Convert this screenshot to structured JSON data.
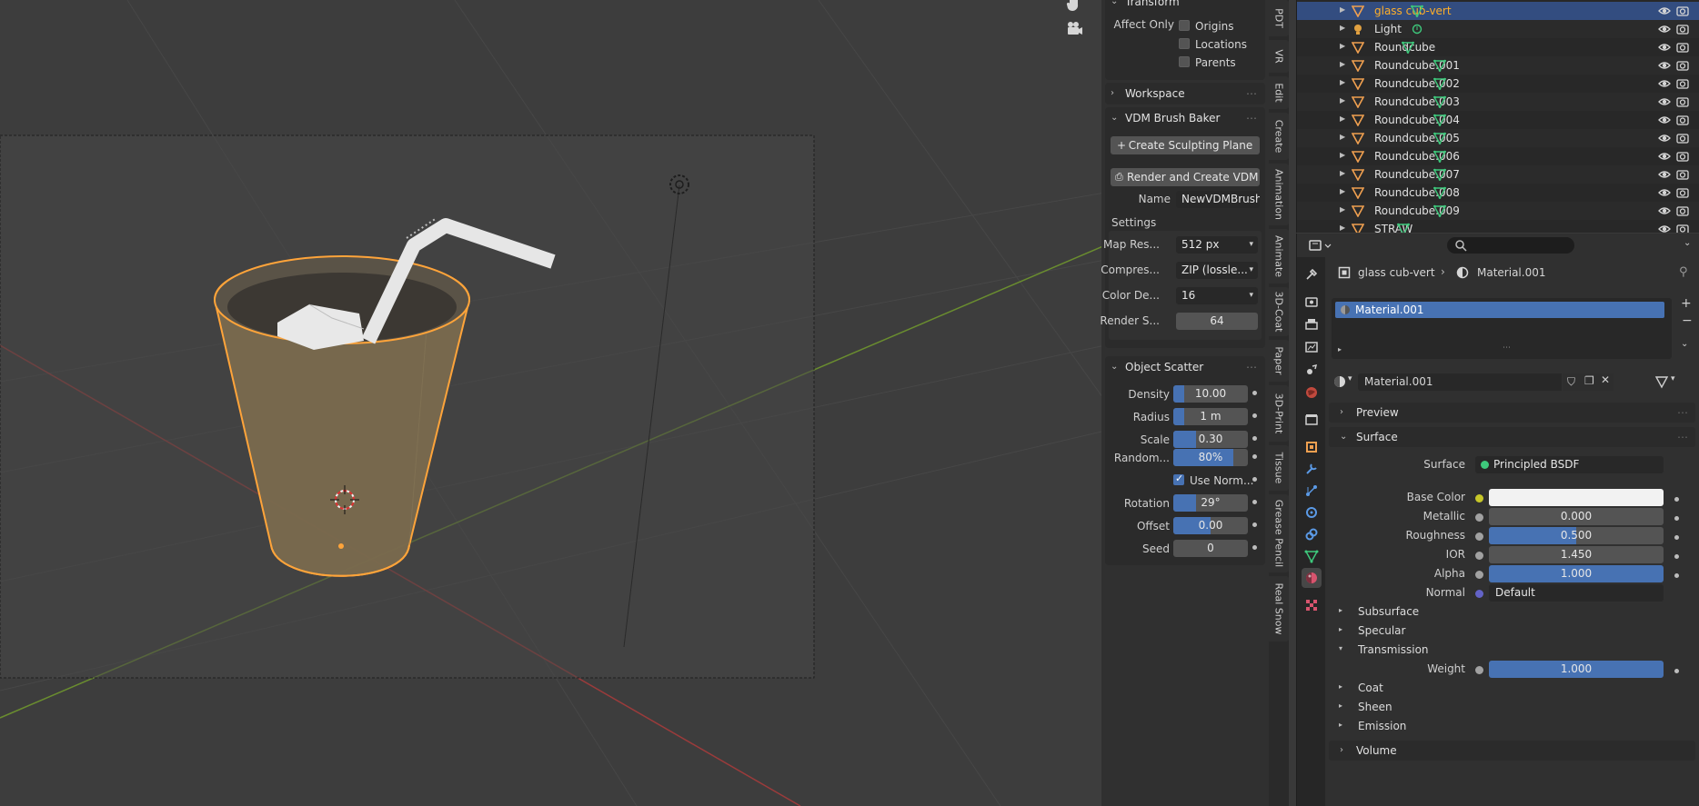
{
  "viewport": {
    "icons": [
      "hand-icon",
      "camera-icon"
    ]
  },
  "npanel": {
    "transform": {
      "title": "Transform",
      "affect_only_label": "Affect Only",
      "options": [
        {
          "label": "Origins",
          "checked": false
        },
        {
          "label": "Locations",
          "checked": false
        },
        {
          "label": "Parents",
          "checked": false
        }
      ]
    },
    "workspace": {
      "title": "Workspace"
    },
    "vdm": {
      "title": "VDM Brush Baker",
      "create_plane": "Create Sculpting Plane",
      "render_create": "Render and Create VDM B...",
      "name_label": "Name",
      "name_value": "NewVDMBrush",
      "settings_label": "Settings",
      "map_res_label": "Map Res...",
      "map_res_value": "512 px",
      "compress_label": "Compres...",
      "compress_value": "ZIP (lossle...",
      "color_depth_label": "Color De...",
      "color_depth_value": "16",
      "render_samples_label": "Render S...",
      "render_samples_value": "64"
    },
    "scatter": {
      "title": "Object Scatter",
      "density_label": "Density",
      "density_value": "10.00",
      "density_fill": 0.15,
      "radius_label": "Radius",
      "radius_value": "1 m",
      "radius_fill": 0.15,
      "scale_label": "Scale",
      "scale_value": "0.30",
      "scale_fill": 0.3,
      "random_label": "Random...",
      "random_value": "80%",
      "random_fill": 0.8,
      "use_normal_label": "Use Norm...",
      "use_normal_checked": true,
      "rotation_label": "Rotation",
      "rotation_value": "29°",
      "rotation_fill": 0.3,
      "offset_label": "Offset",
      "offset_value": "0.00",
      "offset_fill": 0.5,
      "seed_label": "Seed",
      "seed_value": "0"
    },
    "tabs": [
      "PDT",
      "VR",
      "Edit",
      "Create",
      "Animation",
      "Animate",
      "3D-Coat",
      "Paper",
      "3D-Print",
      "Tissue",
      "Grease Pencil",
      "Real Snow"
    ]
  },
  "outliner": {
    "rows": [
      {
        "name": "glass cub-vert",
        "type": "mesh",
        "selected": true,
        "modifier": "mesh-data"
      },
      {
        "name": "Light",
        "type": "light",
        "selected": false,
        "modifier": "light-data"
      },
      {
        "name": "Roundcube",
        "type": "mesh",
        "selected": false,
        "modifier": "mesh-data"
      },
      {
        "name": "Roundcube.001",
        "type": "mesh",
        "selected": false,
        "modifier": "mesh-data"
      },
      {
        "name": "Roundcube.002",
        "type": "mesh",
        "selected": false,
        "modifier": "mesh-data"
      },
      {
        "name": "Roundcube.003",
        "type": "mesh",
        "selected": false,
        "modifier": "mesh-data"
      },
      {
        "name": "Roundcube.004",
        "type": "mesh",
        "selected": false,
        "modifier": "mesh-data"
      },
      {
        "name": "Roundcube.005",
        "type": "mesh",
        "selected": false,
        "modifier": "mesh-data"
      },
      {
        "name": "Roundcube.006",
        "type": "mesh",
        "selected": false,
        "modifier": "mesh-data"
      },
      {
        "name": "Roundcube.007",
        "type": "mesh",
        "selected": false,
        "modifier": "mesh-data"
      },
      {
        "name": "Roundcube.008",
        "type": "mesh",
        "selected": false,
        "modifier": "mesh-data"
      },
      {
        "name": "Roundcube.009",
        "type": "mesh",
        "selected": false,
        "modifier": "mesh-data"
      },
      {
        "name": "STRAW",
        "type": "mesh",
        "selected": false,
        "modifier": "mesh-data"
      }
    ]
  },
  "properties": {
    "breadcrumb_object": "glass cub-vert",
    "breadcrumb_material": "Material.001",
    "slot_name": "Material.001",
    "material_name": "Material.001",
    "preview_label": "Preview",
    "surface_panel": "Surface",
    "surface_label": "Surface",
    "surface_value": "Principled BSDF",
    "base_color_label": "Base Color",
    "base_color": "#f2f2f2",
    "metallic_label": "Metallic",
    "metallic_value": "0.000",
    "roughness_label": "Roughness",
    "roughness_value": "0.500",
    "roughness_fill": 0.5,
    "ior_label": "IOR",
    "ior_value": "1.450",
    "alpha_label": "Alpha",
    "alpha_value": "1.000",
    "normal_label": "Normal",
    "normal_value": "Default",
    "subsurface_label": "Subsurface",
    "specular_label": "Specular",
    "transmission_label": "Transmission",
    "weight_label": "Weight",
    "weight_value": "1.000",
    "coat_label": "Coat",
    "sheen_label": "Sheen",
    "emission_label": "Emission",
    "volume_label": "Volume"
  },
  "colors": {
    "accent": "#4772b3",
    "selection_orange": "#ffaf29",
    "outliner_selected": "#334d80",
    "mesh_icon": "#f0a050",
    "modifier_green": "#3ec97c"
  }
}
